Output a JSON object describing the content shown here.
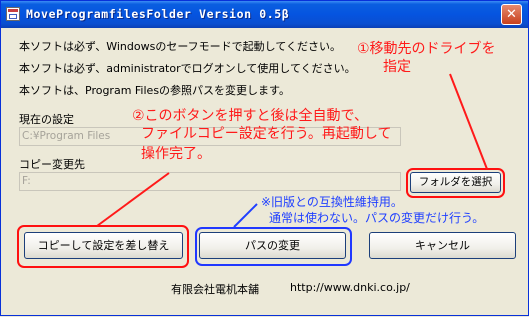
{
  "window": {
    "title": "MoveProgramfilesFolder Version 0.5β"
  },
  "intro_lines": [
    "本ソフトは必ず、Windowsのセーフモードで起動してください。",
    "本ソフトは必ず、administratorでログオンして使用してください。",
    "本ソフトは、Program Filesの参照パスを変更します。"
  ],
  "current": {
    "label": "現在の設定",
    "value": "C:¥Program Files"
  },
  "destination": {
    "label": "コピー変更先",
    "value": "F:",
    "folder_button": "フォルダを選択"
  },
  "buttons": {
    "copy_replace": "コピーして設定を差し替え",
    "change_path": "パスの変更",
    "cancel": "キャンセル"
  },
  "footer": {
    "company": "有限会社電机本舗",
    "url": "http://www.dnki.co.jp/"
  },
  "annotations": {
    "step1": [
      "①移動先のドライブを",
      "指定"
    ],
    "step2": [
      "②このボタンを押すと後は全自動で、",
      "ファイルコピー設定を行う。再起動して",
      "操作完了。"
    ],
    "note": [
      "※旧版との互換性維持用。",
      "通常は使わない。パスの変更だけ行う。"
    ]
  },
  "colors": {
    "annotation_red": "#ff1a1a",
    "annotation_blue": "#2040ff",
    "titlebar": "#0554e0",
    "window_face": "#ece9d8"
  }
}
